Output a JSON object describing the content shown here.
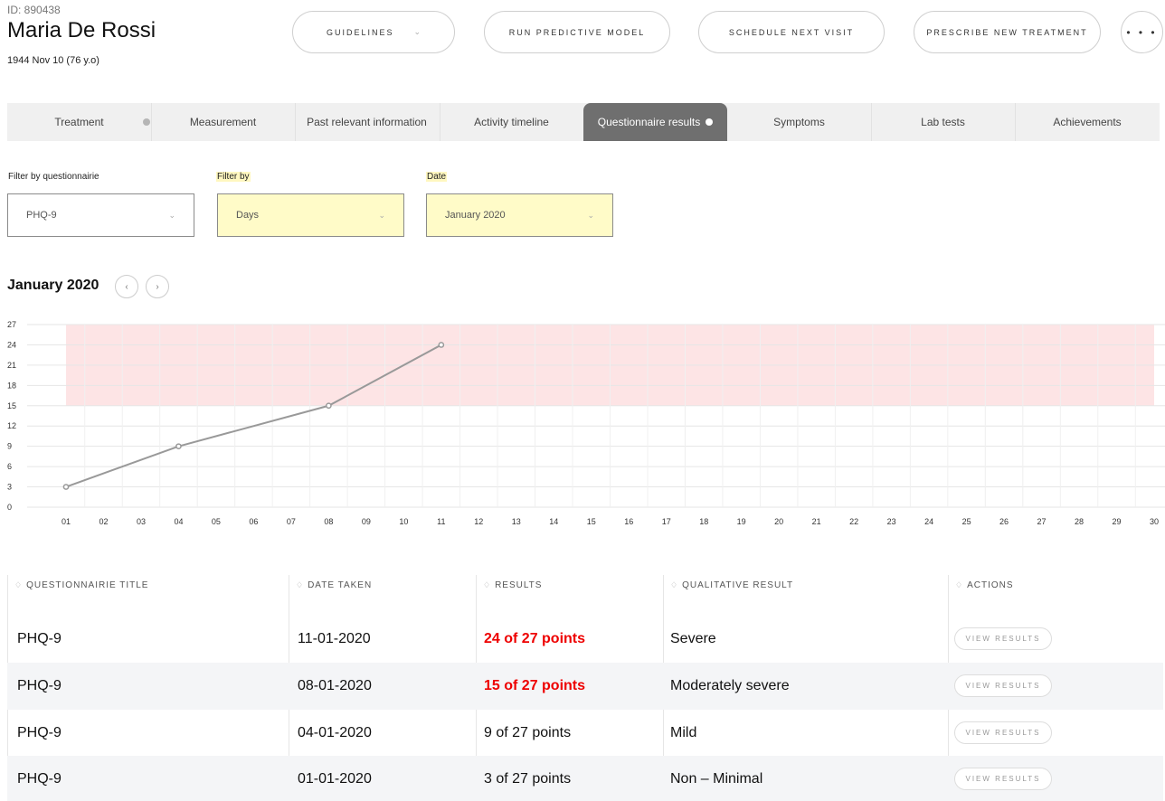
{
  "patient": {
    "id_label": "ID: 890438",
    "name": "Maria De Rossi",
    "dob": "1944 Nov 10 (76 y.o)"
  },
  "header": {
    "guidelines_label": "GUIDELINES",
    "run_model_label": "RUN PREDICTIVE MODEL",
    "schedule_label": "SCHEDULE NEXT VISIT",
    "prescribe_label": "PRESCRIBE NEW TREATMENT",
    "more_label": "• • •"
  },
  "tabs": [
    {
      "label": "Treatment",
      "dot": "#b5b5b5"
    },
    {
      "label": "Measurement"
    },
    {
      "label": "Past relevant information"
    },
    {
      "label": "Activity timeline"
    },
    {
      "label": "Questionnaire results",
      "active": true,
      "dot": "#ffffff"
    },
    {
      "label": "Symptoms"
    },
    {
      "label": "Lab tests"
    },
    {
      "label": "Achievements"
    }
  ],
  "filters": {
    "questionnaire": {
      "label": "Filter by questionnairie",
      "value": "PHQ-9"
    },
    "filter_by": {
      "label": "Filter by",
      "value": "Days"
    },
    "date": {
      "label": "Date",
      "value": "January 2020"
    }
  },
  "month_title": "January 2020",
  "colors": {
    "threshold_band": "#fde4e5",
    "line": "#999999",
    "severe_text": "#e00000",
    "active_tab": "#6f6f6f",
    "highlight": "#fffbc8"
  },
  "chart_data": {
    "type": "line",
    "x_ticks": [
      "01",
      "02",
      "03",
      "04",
      "05",
      "06",
      "07",
      "08",
      "09",
      "10",
      "11",
      "12",
      "13",
      "14",
      "15",
      "16",
      "17",
      "18",
      "19",
      "20",
      "21",
      "22",
      "23",
      "24",
      "25",
      "26",
      "27",
      "28",
      "29",
      "30"
    ],
    "y_ticks": [
      0,
      3,
      6,
      9,
      12,
      15,
      18,
      21,
      24,
      27
    ],
    "ylim": [
      0,
      27
    ],
    "xlim": [
      1,
      30
    ],
    "grid": true,
    "series": [
      {
        "x": [
          1,
          4,
          8,
          11
        ],
        "y": [
          3,
          9,
          15,
          24
        ]
      }
    ],
    "threshold_band": {
      "y_from": 15,
      "y_to": 27,
      "x_from": 1,
      "x_to": 30
    }
  },
  "table": {
    "headers": [
      "QUESTIONNAIRIE TITLE",
      "DATE TAKEN",
      "RESULTS",
      "QUALITATIVE RESULT",
      "ACTIONS"
    ],
    "action_label": "VIEW RESULTS",
    "rows": [
      {
        "title": "PHQ-9",
        "date": "11-01-2020",
        "result": "24 of 27 points",
        "qualitative": "Severe",
        "severe": true
      },
      {
        "title": "PHQ-9",
        "date": "08-01-2020",
        "result": "15 of 27 points",
        "qualitative": "Moderately severe",
        "severe": true
      },
      {
        "title": "PHQ-9",
        "date": "04-01-2020",
        "result": "9 of 27 points",
        "qualitative": "Mild",
        "severe": false
      },
      {
        "title": "PHQ-9",
        "date": "01-01-2020",
        "result": "3 of 27 points",
        "qualitative": "Non – Minimal",
        "severe": false
      }
    ]
  }
}
